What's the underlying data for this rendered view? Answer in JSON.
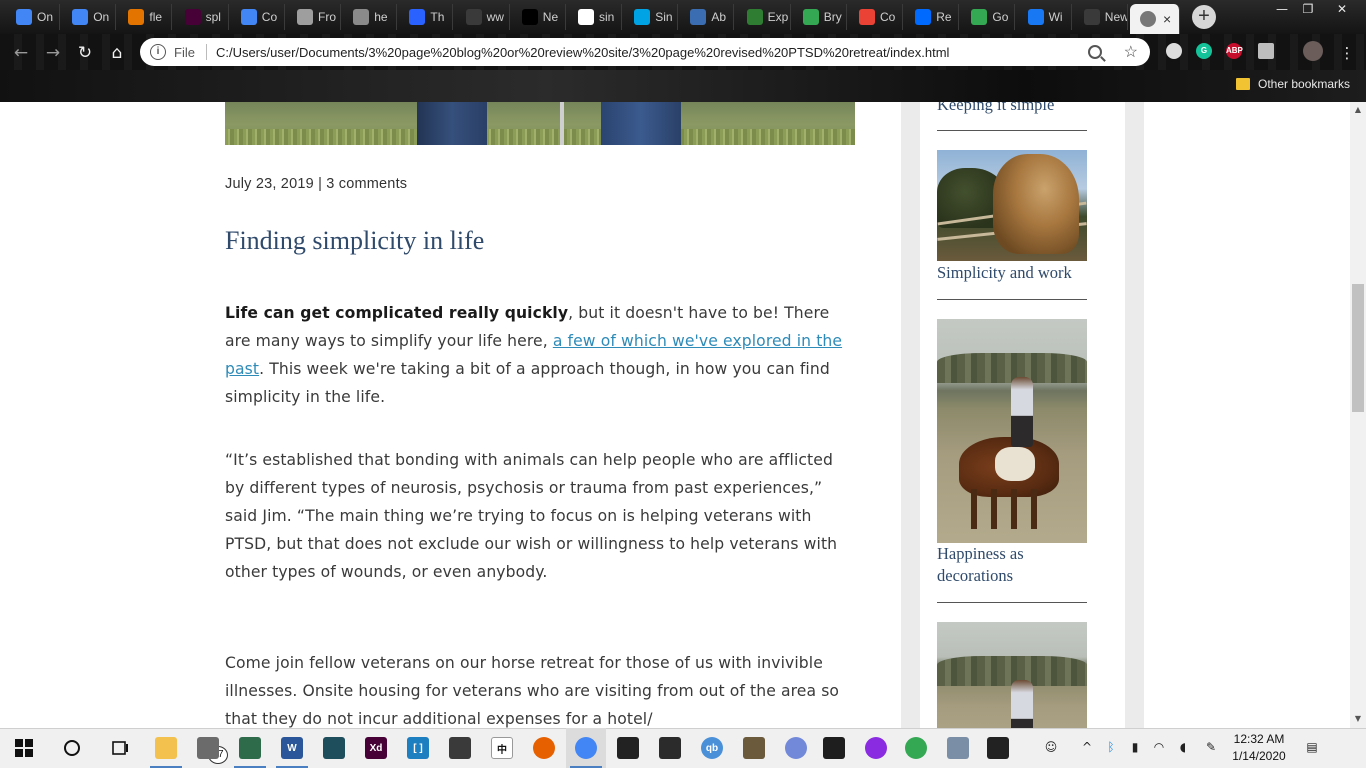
{
  "browser": {
    "tabs": [
      {
        "label": "On",
        "icon": "diamond-icon",
        "color": "#4285f4"
      },
      {
        "label": "On",
        "icon": "diamond-icon",
        "color": "#4285f4"
      },
      {
        "label": "fle",
        "icon": "chart-icon",
        "color": "#e37400"
      },
      {
        "label": "spl",
        "icon": "xd-icon",
        "color": "#470137"
      },
      {
        "label": "Co",
        "icon": "docs-icon",
        "color": "#4285f4"
      },
      {
        "label": "Fro",
        "icon": "page-icon",
        "color": "#9e9e9e"
      },
      {
        "label": "he",
        "icon": "globe-icon",
        "color": "#8a8a8a"
      },
      {
        "label": "Th",
        "icon": "trend-icon",
        "color": "#2962ff"
      },
      {
        "label": "ww",
        "icon": "blank-icon",
        "color": "#3a3a3a"
      },
      {
        "label": "Ne",
        "icon": "rr-icon",
        "color": "#000000"
      },
      {
        "label": "sin",
        "icon": "google-icon",
        "color": "#ffffff"
      },
      {
        "label": "Sin",
        "icon": "sync-icon",
        "color": "#00a4e4"
      },
      {
        "label": "Ab",
        "icon": "seal-icon",
        "color": "#3b6db3"
      },
      {
        "label": "Exp",
        "icon": "globe-icon",
        "color": "#2e7d32"
      },
      {
        "label": "Bry",
        "icon": "maps-icon",
        "color": "#34a853"
      },
      {
        "label": "Co",
        "icon": "gmail-icon",
        "color": "#ea4335"
      },
      {
        "label": "Re",
        "icon": "zillow-icon",
        "color": "#006aff"
      },
      {
        "label": "Go",
        "icon": "maps-icon",
        "color": "#34a853"
      },
      {
        "label": "Wi",
        "icon": "facebook-icon",
        "color": "#1877f2"
      },
      {
        "label": "New Ta",
        "icon": "blank-icon",
        "color": "#3a3a3a"
      }
    ],
    "active_tab_close": "×",
    "new_tab": "+",
    "window_controls": {
      "minimize": "—",
      "restore": "❐",
      "close": "✕"
    },
    "nav": {
      "back": "←",
      "forward": "→",
      "reload": "↻",
      "home": "⌂"
    },
    "omnibox": {
      "info": "i",
      "scheme": "File",
      "url": "C:/Users/user/Documents/3%20page%20blog%20or%20review%20site/3%20page%20revised%20PTSD%20retreat/index.html"
    },
    "extensions": [
      {
        "name": "half-moon-icon",
        "label": "",
        "color": "#dddddd"
      },
      {
        "name": "grammarly-icon",
        "label": "G",
        "color": "#15c39a"
      },
      {
        "name": "adblock-icon",
        "label": "ABP",
        "color": "#c70d2c"
      },
      {
        "name": "mail-ext-icon",
        "label": "",
        "color": "#bdbdbd"
      },
      {
        "name": "profile-avatar-icon",
        "label": "",
        "color": "#6a5d5a"
      }
    ],
    "menu": "⋮",
    "bookmarks": {
      "other_label": "Other bookmarks"
    }
  },
  "post": {
    "meta": "July 23, 2019 | 3 comments",
    "title": "Finding simplicity in life",
    "p1_bold": "Life can get complicated really quickly",
    "p1_a": ", but it doesn't have to be! There are many ways to simplify your life here, ",
    "p1_link": "a few of which we've explored in the past",
    "p1_b": ". This week we're taking a bit of a approach though, in how you can find simplicity in the life.",
    "p2": "“It’s established that bonding with animals can help people who are afflicted by different types of neurosis, psychosis or trauma from past experiences,” said Jim. “The main thing we’re trying to focus on is helping veterans with PTSD, but that does not exclude our wish or willingness to help veterans with other types of wounds, or even anybody.",
    "p3": "Come join fellow veterans on our horse retreat for those of us with invivible illnesses. Onsite housing for veterans who are visiting from out of the area so that they do not incur additional expenses for a hotel/"
  },
  "sidebar": {
    "items": [
      {
        "title": "Keeping it simple"
      },
      {
        "title": "Simplicity and work"
      },
      {
        "title": "Happiness as decorations"
      }
    ]
  },
  "taskbar": {
    "apps": [
      {
        "name": "file-explorer-icon",
        "label": "",
        "color": "#f2c14e",
        "running": true
      },
      {
        "name": "mail-tray-icon",
        "label": "",
        "color": "#6b6b6b",
        "running": false
      },
      {
        "name": "excel-like-icon",
        "label": "",
        "color": "#2e6b4b",
        "running": true
      },
      {
        "name": "word-icon",
        "label": "W",
        "color": "#2b579a",
        "running": true
      },
      {
        "name": "codeblock-icon",
        "label": "",
        "color": "#1e4d5c",
        "running": false
      },
      {
        "name": "xd-app-icon",
        "label": "Xd",
        "color": "#470137",
        "running": false
      },
      {
        "name": "brackets-icon",
        "label": "[ ]",
        "color": "#1e7fc0",
        "running": false
      },
      {
        "name": "photo-icon",
        "label": "",
        "color": "#3a3a3a",
        "running": false
      },
      {
        "name": "chinese-char-icon",
        "label": "中",
        "color": "#ffffff",
        "running": false
      },
      {
        "name": "firefox-icon",
        "label": "",
        "color": "#e66000",
        "running": false
      },
      {
        "name": "chrome-icon",
        "label": "",
        "color": "#4285f4",
        "running": true,
        "active": true
      },
      {
        "name": "inkscape-icon",
        "label": "",
        "color": "#222222",
        "running": false
      },
      {
        "name": "calculator-icon",
        "label": "",
        "color": "#2b2b2b",
        "running": false
      },
      {
        "name": "qb-icon",
        "label": "qb",
        "color": "#4a90d9",
        "running": false
      },
      {
        "name": "gimp-icon",
        "label": "",
        "color": "#6b5a3c",
        "running": false
      },
      {
        "name": "discord-icon",
        "label": "",
        "color": "#7289da",
        "running": false
      },
      {
        "name": "terminal-icon",
        "label": "",
        "color": "#1e1e1e",
        "running": false
      },
      {
        "name": "podcast-icon",
        "label": "",
        "color": "#8a2be2",
        "running": false
      },
      {
        "name": "chrome-alt-icon",
        "label": "",
        "color": "#34a853",
        "running": false
      },
      {
        "name": "monitor-icon",
        "label": "",
        "color": "#7a8fa6",
        "running": false
      },
      {
        "name": "onedrive-icon",
        "label": "",
        "color": "#222222",
        "running": false
      }
    ],
    "mail_count": "57",
    "clock_time": "12:32 AM",
    "clock_date": "1/14/2020"
  }
}
